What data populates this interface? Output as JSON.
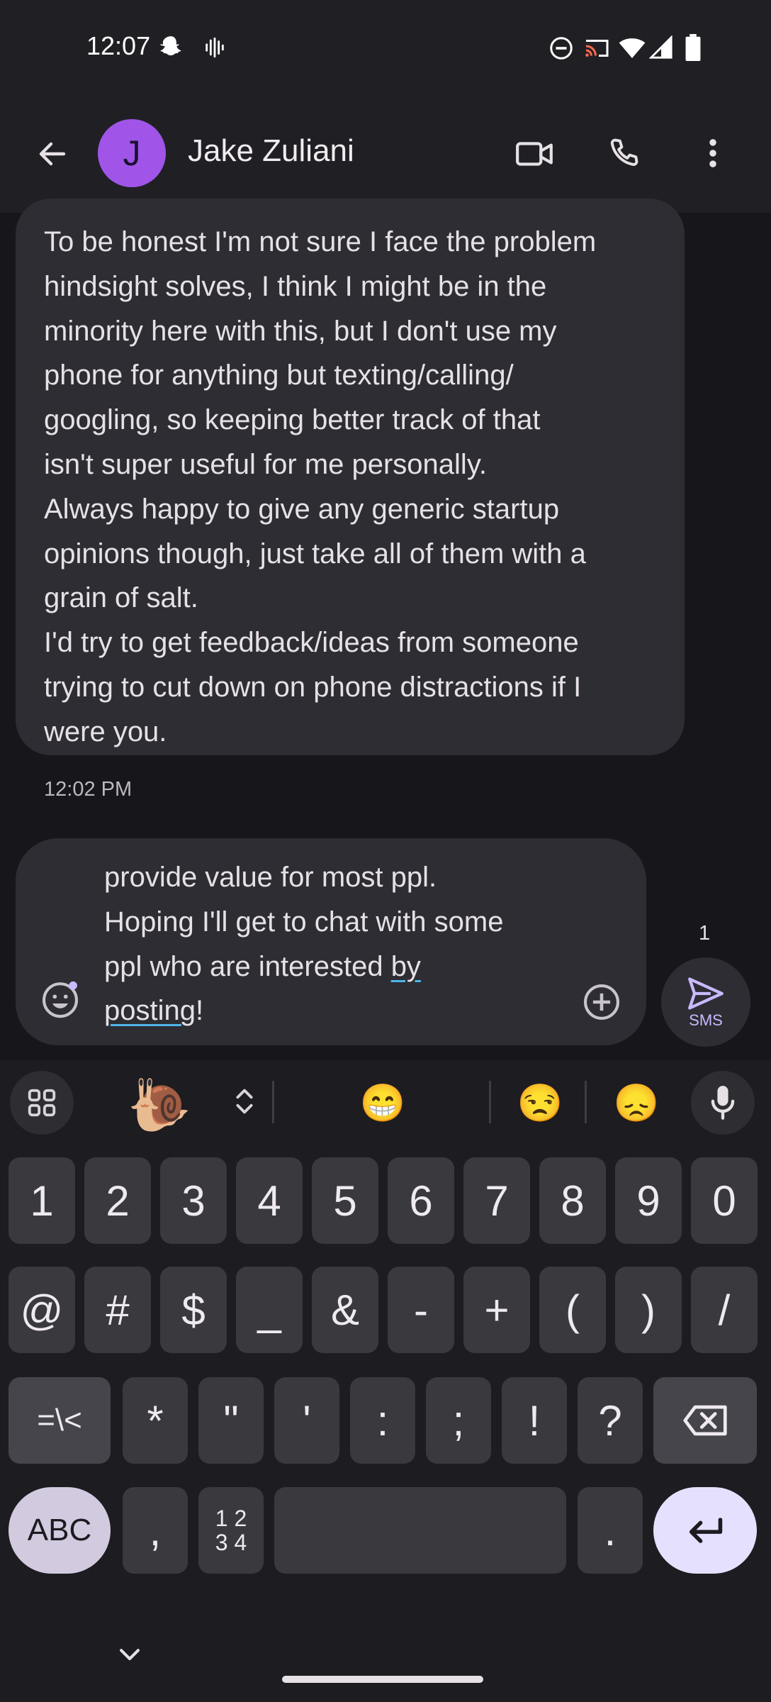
{
  "status_bar": {
    "time": "12:07"
  },
  "header": {
    "avatar_letter": "J",
    "contact_name": "Jake Zuliani"
  },
  "conversation": {
    "message_text": "To be honest I'm not sure I face the problem\nhindsight solves, I think I might be in the\nminority here with this, but I don't use my\nphone for anything but texting/calling/\ngoogling, so keeping better track of that\nisn't super useful for me personally.\nAlways happy to give any generic startup\nopinions though, just take all of them with a\ngrain of salt.\nI'd try to get feedback/ideas from someone\ntrying to cut down on phone distractions if I\nwere you.",
    "message_time": "12:02 PM"
  },
  "compose": {
    "line1": "provide value for most ppl.",
    "line2": "Hoping I'll get to chat with some",
    "line3_prefix": "ppl who are interested ",
    "line3_underlined": "by",
    "line4_underlined": "posting",
    "line4_suffix": "!",
    "send_count": "1",
    "send_label": "SMS"
  },
  "suggestions": {
    "sticker": "🐌",
    "emoji1": "😁",
    "emoji2": "😒",
    "emoji3": "😞"
  },
  "keyboard": {
    "row1": [
      "1",
      "2",
      "3",
      "4",
      "5",
      "6",
      "7",
      "8",
      "9",
      "0"
    ],
    "row2": [
      "@",
      "#",
      "$",
      "_",
      "&",
      "-",
      "+",
      "(",
      ")",
      "/"
    ],
    "row3_switch": "=\\<",
    "row3": [
      "*",
      "\"",
      "'",
      ":",
      ";",
      "!",
      "?"
    ],
    "abc": "ABC",
    "comma": ",",
    "numpad_top": "1 2",
    "numpad_bottom": "3 4",
    "period": ".",
    "accent_color": "#e6e0ff"
  },
  "icons": [
    "back-arrow-icon",
    "video-call-icon",
    "phone-icon",
    "more-vert-icon",
    "emoji-icon",
    "add-circle-icon",
    "send-icon",
    "apps-grid-icon",
    "expand-icon",
    "mic-icon",
    "backspace-icon",
    "enter-icon",
    "chevron-down-icon",
    "snapchat-icon",
    "voice-icon",
    "dnd-icon",
    "cast-icon",
    "wifi-icon",
    "signal-icon",
    "battery-icon"
  ]
}
